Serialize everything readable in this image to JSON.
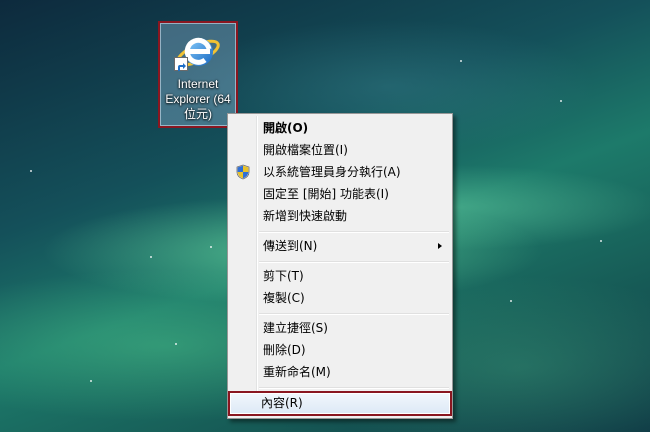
{
  "desktop": {
    "icon": {
      "label": "Internet\nExplorer (64\n位元)",
      "icon_name": "internet-explorer-icon"
    }
  },
  "context_menu": {
    "items": [
      {
        "label": "開啟(O)",
        "bold": true
      },
      {
        "label": "開啟檔案位置(I)"
      },
      {
        "label": "以系統管理員身分執行(A)",
        "icon": "uac-shield-icon"
      },
      {
        "label": "固定至 [開始] 功能表(I)"
      },
      {
        "label": "新增到快速啟動"
      },
      {
        "label": "傳送到(N)",
        "submenu": true
      },
      {
        "label": "剪下(T)"
      },
      {
        "label": "複製(C)"
      },
      {
        "label": "建立捷徑(S)"
      },
      {
        "label": "刪除(D)"
      },
      {
        "label": "重新命名(M)"
      },
      {
        "label": "內容(R)",
        "highlighted": true
      }
    ]
  },
  "colors": {
    "highlight_border": "#8a1620",
    "menu_background": "#f0f0f0"
  }
}
